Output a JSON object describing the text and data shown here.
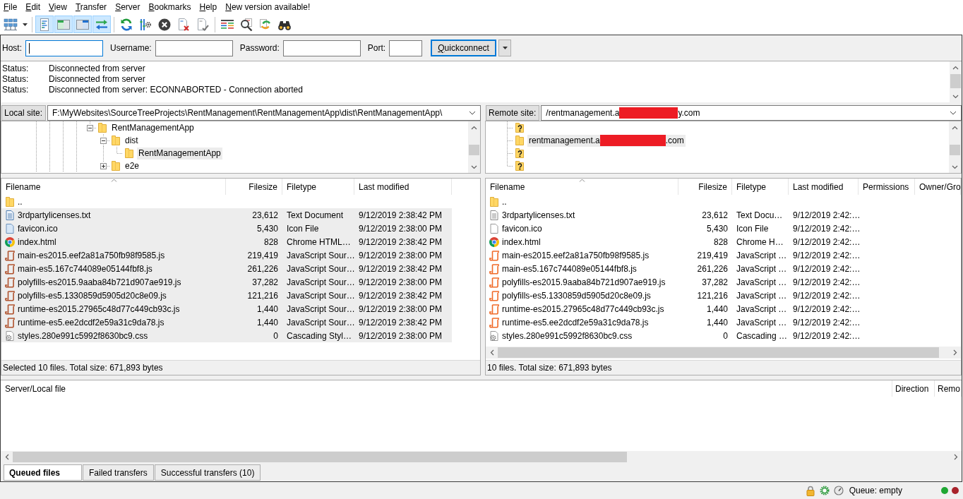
{
  "menu": [
    "File",
    "Edit",
    "View",
    "Transfer",
    "Server",
    "Bookmarks",
    "Help",
    "New version available!"
  ],
  "toolbar": {
    "groups": [
      [
        {
          "kind": "site-manager",
          "pressed": false
        },
        {
          "kind": "dropdown",
          "pressed": false
        }
      ],
      [
        {
          "kind": "message-log",
          "pressed": true
        },
        {
          "kind": "local-tree",
          "pressed": true
        },
        {
          "kind": "remote-tree",
          "pressed": true
        },
        {
          "kind": "transfer-queue",
          "pressed": true
        }
      ],
      [
        {
          "kind": "refresh",
          "pressed": false
        },
        {
          "kind": "filter",
          "pressed": false
        },
        {
          "kind": "cancel",
          "pressed": false
        },
        {
          "kind": "disconnect",
          "pressed": false
        },
        {
          "kind": "reconnect",
          "pressed": false
        }
      ],
      [
        {
          "kind": "compare",
          "pressed": false
        },
        {
          "kind": "search",
          "pressed": false
        },
        {
          "kind": "synchronize",
          "pressed": false
        },
        {
          "kind": "find",
          "pressed": false
        }
      ]
    ]
  },
  "quickconnect": {
    "fields": [
      {
        "label": "Host:",
        "focused": true
      },
      {
        "label": "Username:",
        "focused": false
      },
      {
        "label": "Password:",
        "focused": false
      },
      {
        "label": "Port:",
        "focused": false
      }
    ],
    "button": "Quickconnect"
  },
  "message_log": [
    {
      "label": "Status:",
      "text": "Disconnected from server"
    },
    {
      "label": "Status:",
      "text": "Disconnected from server"
    },
    {
      "label": "Status:",
      "text": "Disconnected from server: ECONNABORTED - Connection aborted"
    }
  ],
  "local": {
    "site_label": "Local site:",
    "path": [
      {
        "kind": "text",
        "text": "F:\\MyWebsites\\SourceTreeProjects\\RentManagement\\RentManagementApp\\dist\\RentManagementApp\\"
      }
    ],
    "tree": [
      {
        "kind": "folder",
        "label": "RentManagementApp",
        "selected": false,
        "expanded": true,
        "children": [
          {
            "kind": "folder",
            "label": "dist",
            "selected": false,
            "expanded": true,
            "children": [
              {
                "kind": "folder",
                "label": "RentManagementApp",
                "selected": true
              }
            ]
          },
          {
            "kind": "folder",
            "label": "e2e",
            "selected": false,
            "expanded": false
          }
        ]
      }
    ],
    "columns": [
      {
        "label": "Filename",
        "sorted": true
      },
      {
        "label": "Filesize",
        "sorted": false
      },
      {
        "label": "Filetype",
        "sorted": false
      },
      {
        "label": "Last modified",
        "sorted": false
      }
    ],
    "rows": [
      {
        "kind": "parent",
        "cells": [
          ".."
        ],
        "selected": false
      },
      {
        "kind": "text",
        "cells": [
          "3rdpartylicenses.txt",
          "23,612",
          "Text Document",
          "9/12/2019 2:38:42 PM"
        ],
        "selected": true
      },
      {
        "kind": "image",
        "cells": [
          "favicon.ico",
          "5,430",
          "Icon File",
          "9/12/2019 2:38:00 PM"
        ],
        "selected": true
      },
      {
        "kind": "html",
        "cells": [
          "index.html",
          "828",
          "Chrome HTML…",
          "9/12/2019 2:38:42 PM"
        ],
        "selected": true
      },
      {
        "kind": "script",
        "cells": [
          "main-es2015.eef2a81a750fb98f9585.js",
          "219,419",
          "JavaScript Sour…",
          "9/12/2019 2:38:00 PM"
        ],
        "selected": true
      },
      {
        "kind": "script",
        "cells": [
          "main-es5.167c744089e05144fbf8.js",
          "261,226",
          "JavaScript Sour…",
          "9/12/2019 2:38:42 PM"
        ],
        "selected": true
      },
      {
        "kind": "script",
        "cells": [
          "polyfills-es2015.9aaba84b721d907ae919.js",
          "37,282",
          "JavaScript Sour…",
          "9/12/2019 2:38:00 PM"
        ],
        "selected": true
      },
      {
        "kind": "script",
        "cells": [
          "polyfills-es5.1330859d5905d20c8e09.js",
          "121,216",
          "JavaScript Sour…",
          "9/12/2019 2:38:42 PM"
        ],
        "selected": true
      },
      {
        "kind": "script",
        "cells": [
          "runtime-es2015.27965c48d77c449cb93c.js",
          "1,440",
          "JavaScript Sour…",
          "9/12/2019 2:38:00 PM"
        ],
        "selected": true
      },
      {
        "kind": "script",
        "cells": [
          "runtime-es5.ee2dcdf2e59a31c9da78.js",
          "1,440",
          "JavaScript Sour…",
          "9/12/2019 2:38:42 PM"
        ],
        "selected": true
      },
      {
        "kind": "stylesheet",
        "cells": [
          "styles.280e991c5992f8630bc9.css",
          "0",
          "Cascading Styl…",
          "9/12/2019 2:38:00 PM"
        ],
        "selected": true
      }
    ],
    "status": "Selected 10 files. Total size: 671,893 bytes"
  },
  "remote": {
    "site_label": "Remote site:",
    "path": [
      {
        "kind": "text",
        "text": "/rentmanagement.a"
      },
      {
        "kind": "redaction"
      },
      {
        "kind": "text",
        "text": "y.com"
      }
    ],
    "tree": [
      {
        "kind": "unknown",
        "selected": false
      },
      {
        "kind": "folder",
        "parts": [
          {
            "kind": "text",
            "text": "rentmanagement.a"
          },
          {
            "kind": "redaction"
          },
          {
            "kind": "text",
            "text": ".com"
          }
        ],
        "selected": true
      },
      {
        "kind": "unknown",
        "selected": false
      },
      {
        "kind": "unknown",
        "selected": false
      }
    ],
    "columns": [
      {
        "label": "Filename",
        "sorted": true
      },
      {
        "label": "Filesize",
        "sorted": false
      },
      {
        "label": "Filetype",
        "sorted": false
      },
      {
        "label": "Last modified",
        "sorted": false
      },
      {
        "label": "Permissions",
        "sorted": false
      },
      {
        "label": "Owner/Gro",
        "sorted": false
      }
    ],
    "rows": [
      {
        "kind": "parent",
        "cells": [
          ".."
        ],
        "selected": false
      },
      {
        "kind": "text",
        "cells": [
          "3rdpartylicenses.txt",
          "23,612",
          "Text Docu…",
          "9/12/2019 2:42:…"
        ],
        "selected": false
      },
      {
        "kind": "image",
        "cells": [
          "favicon.ico",
          "5,430",
          "Icon File",
          "9/12/2019 2:42:…"
        ],
        "selected": false
      },
      {
        "kind": "html",
        "cells": [
          "index.html",
          "828",
          "Chrome H…",
          "9/12/2019 2:42:…"
        ],
        "selected": false
      },
      {
        "kind": "script",
        "cells": [
          "main-es2015.eef2a81a750fb98f9585.js",
          "219,419",
          "JavaScript …",
          "9/12/2019 2:42:…"
        ],
        "selected": false
      },
      {
        "kind": "script",
        "cells": [
          "main-es5.167c744089e05144fbf8.js",
          "261,226",
          "JavaScript …",
          "9/12/2019 2:42:…"
        ],
        "selected": false
      },
      {
        "kind": "script",
        "cells": [
          "polyfills-es2015.9aaba84b721d907ae919.js",
          "37,282",
          "JavaScript …",
          "9/12/2019 2:42:…"
        ],
        "selected": false
      },
      {
        "kind": "script",
        "cells": [
          "polyfills-es5.1330859d5905d20c8e09.js",
          "121,216",
          "JavaScript …",
          "9/12/2019 2:42:…"
        ],
        "selected": false
      },
      {
        "kind": "script",
        "cells": [
          "runtime-es2015.27965c48d77c449cb93c.js",
          "1,440",
          "JavaScript …",
          "9/12/2019 2:42:…"
        ],
        "selected": false
      },
      {
        "kind": "script",
        "cells": [
          "runtime-es5.ee2dcdf2e59a31c9da78.js",
          "1,440",
          "JavaScript …",
          "9/12/2019 2:42:…"
        ],
        "selected": false
      },
      {
        "kind": "stylesheet",
        "cells": [
          "styles.280e991c5992f8630bc9.css",
          "0",
          "Cascading …",
          "9/12/2019 2:42:…"
        ],
        "selected": false
      }
    ],
    "status": "10 files. Total size: 671,893 bytes"
  },
  "queue": {
    "columns": [
      "Server/Local file",
      "Direction",
      "Remo"
    ]
  },
  "tabs": [
    {
      "label": "Queued files",
      "selected": true
    },
    {
      "label": "Failed transfers",
      "selected": false
    },
    {
      "label": "Successful transfers (10)",
      "selected": false
    }
  ],
  "status_bar": {
    "queue": "Queue: empty",
    "indicators": [
      {
        "color": "#1fa733"
      },
      {
        "color": "#a8232b"
      }
    ]
  }
}
